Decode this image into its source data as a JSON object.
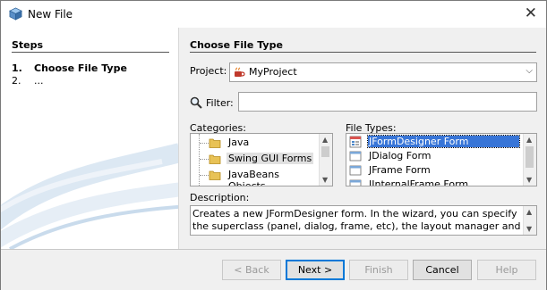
{
  "window": {
    "title": "New File",
    "close_glyph": "✕",
    "icon": "netbeans-cube-icon"
  },
  "steps": {
    "heading": "Steps",
    "items": [
      {
        "num": "1.",
        "label": "Choose File Type"
      },
      {
        "num": "2.",
        "label": "..."
      }
    ]
  },
  "main": {
    "heading": "Choose File Type",
    "project_label": "Project:",
    "project_value": "MyProject",
    "filter_label": "Filter:",
    "filter_value": "",
    "categories_label": "Categories:",
    "categories": [
      "Java",
      "Swing GUI Forms",
      "JavaBeans Objects"
    ],
    "selected_category": "Swing GUI Forms",
    "file_types_label": "File Types:",
    "file_types": [
      "JFormDesigner Form",
      "JDialog Form",
      "JFrame Form",
      "JInternalFrame Form"
    ],
    "selected_file_type": "JFormDesigner Form",
    "description_label": "Description:",
    "description": "Creates a new JFormDesigner form. In the wizard, you can specify the superclass (panel, dialog, frame, etc), the layout manager and localization"
  },
  "buttons": {
    "back": "< Back",
    "next": "Next >",
    "finish": "Finish",
    "cancel": "Cancel",
    "help": "Help"
  },
  "colors": {
    "selection": "#3875d7",
    "default_border": "#0078d7"
  }
}
